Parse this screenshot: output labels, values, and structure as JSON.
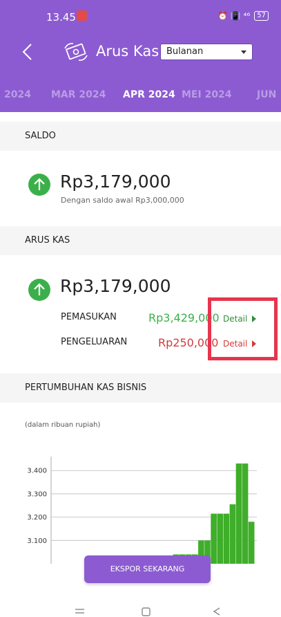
{
  "status": {
    "time": "13.45",
    "indicators": "⏰ 📳 ⁴⁶",
    "battery": "57"
  },
  "appbar": {
    "title": "Arus Kas",
    "period_select": "Bulanan"
  },
  "tabs": [
    "2024",
    "MAR 2024",
    "APR 2024",
    "MEI 2024",
    "JUN"
  ],
  "active_tab": "APR 2024",
  "saldo": {
    "header": "SALDO",
    "amount": "Rp3,179,000",
    "subtitle": "Dengan saldo awal Rp3,000,000"
  },
  "arus_kas": {
    "header": "ARUS KAS",
    "amount": "Rp3,179,000",
    "income_label": "PEMASUKAN",
    "income_value": "Rp3,429,000",
    "expense_label": "PENGELUARAN",
    "expense_value": "Rp250,000",
    "detail_label": "Detail"
  },
  "growth": {
    "header": "PERTUMBUHAN KAS BISNIS",
    "note": "(dalam ribuan rupiah)"
  },
  "chart_data": {
    "type": "bar",
    "title": "",
    "xlabel": "",
    "ylabel": "",
    "yticks": [
      "3.100",
      "3.200",
      "3.300",
      "3.400"
    ],
    "ylim": [
      3000,
      3460
    ],
    "values": [
      3040,
      3040,
      3040,
      3040,
      3100,
      3100,
      3215,
      3215,
      3215,
      3255,
      3430,
      3430,
      3180
    ],
    "color": "#3fae2a",
    "grid": true
  },
  "export_button": "EKSPOR SEKARANG",
  "colors": {
    "primary": "#8c5bd1",
    "income": "#3bb04a",
    "expense": "#d13a3a",
    "highlight": "#e8344d"
  }
}
